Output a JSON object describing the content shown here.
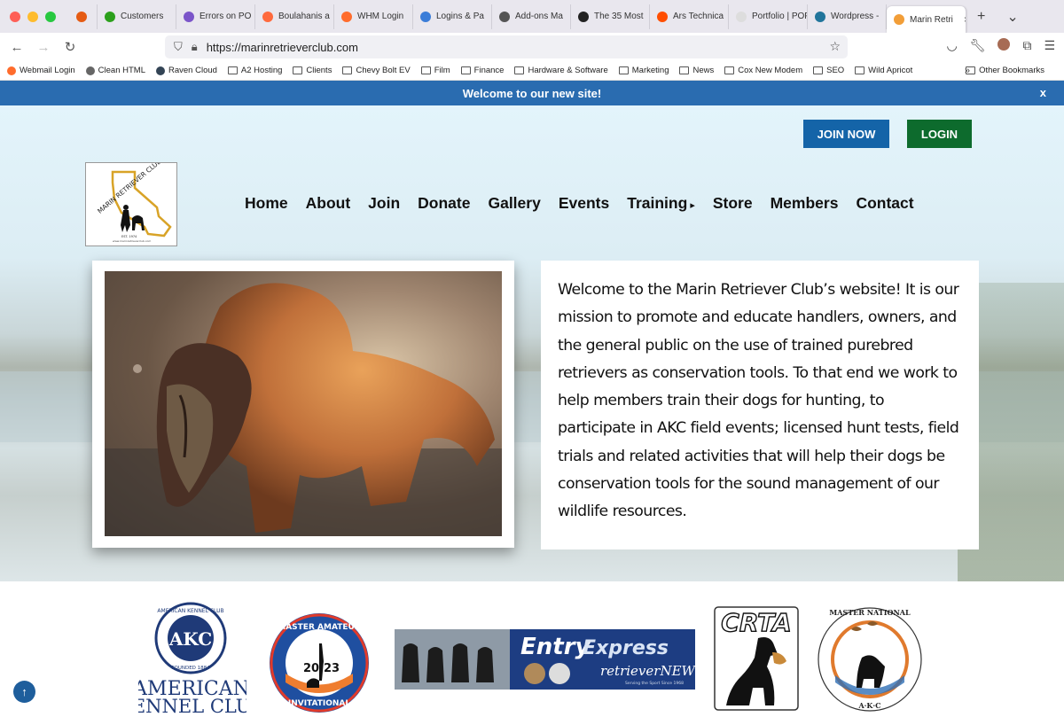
{
  "browser": {
    "tabs": [
      {
        "label": "",
        "color": "#e55b13"
      },
      {
        "label": "Customers",
        "color": "#2ca01c"
      },
      {
        "label": "Errors on PO",
        "color": "#7b55c9"
      },
      {
        "label": "Boulahanis a",
        "color": "#ff6a3d"
      },
      {
        "label": "WHM Login",
        "color": "#ff6c2c"
      },
      {
        "label": "Logins & Pa",
        "color": "#3b7dd8"
      },
      {
        "label": "Add-ons Ma",
        "color": "#555555"
      },
      {
        "label": "The 35 Most",
        "color": "#222222"
      },
      {
        "label": "Ars Technica",
        "color": "#ff4e00"
      },
      {
        "label": "Portfolio | POPCK",
        "color": "#dddddd"
      },
      {
        "label": "Wordpress -",
        "color": "#21759b"
      },
      {
        "label": "Marin Retri",
        "color": "#f29e38",
        "active": true
      }
    ],
    "url": "https://marinretrieverclub.com",
    "bookmarks": [
      {
        "label": "Webmail Login",
        "type": "dot",
        "color": "#ff6c2c"
      },
      {
        "label": "Clean HTML",
        "type": "dot",
        "color": "#666666"
      },
      {
        "label": "Raven Cloud",
        "type": "dot",
        "color": "#334455"
      },
      {
        "label": "A2 Hosting",
        "type": "folder"
      },
      {
        "label": "Clients",
        "type": "folder"
      },
      {
        "label": "Chevy Bolt EV",
        "type": "folder"
      },
      {
        "label": "Film",
        "type": "folder"
      },
      {
        "label": "Finance",
        "type": "folder"
      },
      {
        "label": "Hardware & Software",
        "type": "folder"
      },
      {
        "label": "Marketing",
        "type": "folder"
      },
      {
        "label": "News",
        "type": "folder"
      },
      {
        "label": "Cox New Modem",
        "type": "folder"
      },
      {
        "label": "SEO",
        "type": "folder"
      },
      {
        "label": "Wild Apricot",
        "type": "folder"
      }
    ],
    "other_bookmarks": "Other Bookmarks"
  },
  "site": {
    "announcement": "Welcome to our new site!",
    "announcement_close": "x",
    "join_label": "JOIN NOW",
    "login_label": "LOGIN",
    "logo": {
      "text": "MARIN RETRIEVER CLUB",
      "est": "EST. 1974",
      "url": "www.marinretrieverclub.com"
    },
    "nav": [
      {
        "label": "Home"
      },
      {
        "label": "About"
      },
      {
        "label": "Join"
      },
      {
        "label": "Donate"
      },
      {
        "label": "Gallery"
      },
      {
        "label": "Events"
      },
      {
        "label": "Training",
        "submenu": true
      },
      {
        "label": "Store"
      },
      {
        "label": "Members"
      },
      {
        "label": "Contact"
      }
    ],
    "intro": "Welcome to the Marin Retriever Club’s website! It is our mission to promote and educate handlers, owners, and the general public on the use of trained purebred retrievers as conservation tools. To that end we work to help members train their dogs for hunting, to participate in AKC field events; licensed hunt tests, field trials and related activities that will help their dogs be conservation tools for the sound management of our wildlife resources.",
    "partners": {
      "akc": {
        "ring_text": "AMERICAN KENNEL CLUB",
        "center": "AKC",
        "founded": "FOUNDED 1884",
        "name1": "AMERICAN",
        "name2": "KENNEL CLUB"
      },
      "master_amateur": {
        "top": "MASTER AMATEUR",
        "year_left": "20",
        "year_right": "23",
        "bottom": "INVITATIONAL"
      },
      "entry_express": {
        "title1": "Entry",
        "title2": "Express",
        "sub": "retrieverNEWS",
        "tag": "Serving the Sport Since 1968"
      },
      "crta": {
        "title": "CRTA"
      },
      "master_national": {
        "ring_text": "MASTER NATIONAL",
        "bottom": "A·K·C"
      }
    }
  }
}
